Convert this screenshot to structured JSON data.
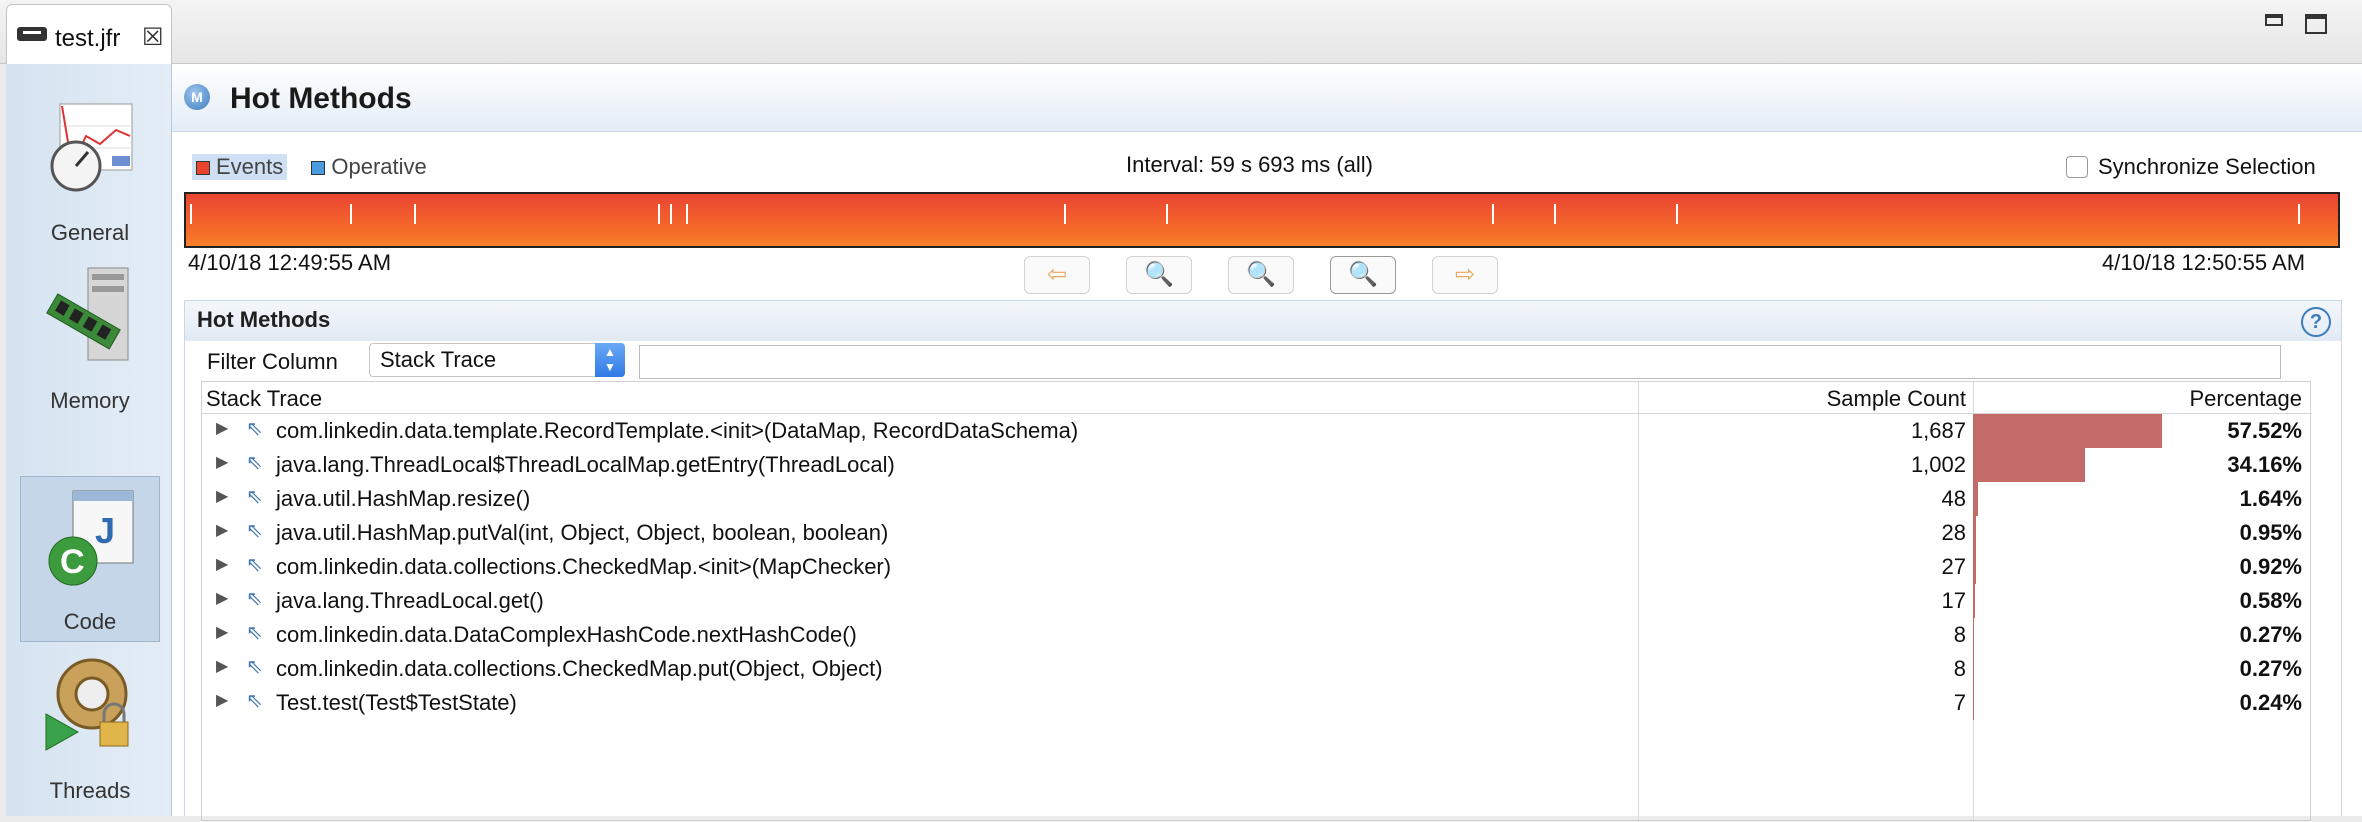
{
  "tab": {
    "title": "test.jfr",
    "close": "☒"
  },
  "sidebar": {
    "items": [
      {
        "label": "General",
        "selected": false
      },
      {
        "label": "Memory",
        "selected": false
      },
      {
        "label": "Code",
        "selected": true
      },
      {
        "label": "Threads",
        "selected": false
      }
    ]
  },
  "page": {
    "icon_letter": "M",
    "title": "Hot Methods"
  },
  "timeline": {
    "legend": [
      {
        "label": "Events",
        "color": "#e8452c",
        "active": true
      },
      {
        "label": "Operative",
        "color": "#4a9be0",
        "active": false
      }
    ],
    "interval": "Interval: 59 s 693 ms (all)",
    "sync_label": "Synchronize Selection",
    "start_time": "4/10/18 12:49:55 AM",
    "end_time": "4/10/18 12:50:55 AM",
    "buttons": {
      "back": "⇦",
      "zoom_out": "🔍",
      "zoom_out_alt": "🔍",
      "zoom_in": "🔍",
      "forward": "⇨"
    }
  },
  "section": {
    "title": "Hot Methods",
    "help": "?",
    "filter_label": "Filter Column",
    "filter_value": "Stack Trace",
    "filter_text": ""
  },
  "table": {
    "columns": [
      "Stack Trace",
      "Sample Count",
      "Percentage"
    ],
    "rows": [
      {
        "trace": "com.linkedin.data.template.RecordTemplate.<init>(DataMap, RecordDataSchema)",
        "count": "1,687",
        "pct": "57.52%",
        "frac": 0.5752
      },
      {
        "trace": "java.lang.ThreadLocal$ThreadLocalMap.getEntry(ThreadLocal)",
        "count": "1,002",
        "pct": "34.16%",
        "frac": 0.3416
      },
      {
        "trace": "java.util.HashMap.resize()",
        "count": "48",
        "pct": "1.64%",
        "frac": 0.0164
      },
      {
        "trace": "java.util.HashMap.putVal(int, Object, Object, boolean, boolean)",
        "count": "28",
        "pct": "0.95%",
        "frac": 0.0095
      },
      {
        "trace": "com.linkedin.data.collections.CheckedMap.<init>(MapChecker)",
        "count": "27",
        "pct": "0.92%",
        "frac": 0.0092
      },
      {
        "trace": "java.lang.ThreadLocal.get()",
        "count": "17",
        "pct": "0.58%",
        "frac": 0.0058
      },
      {
        "trace": "com.linkedin.data.DataComplexHashCode.nextHashCode()",
        "count": "8",
        "pct": "0.27%",
        "frac": 0.0027
      },
      {
        "trace": "com.linkedin.data.collections.CheckedMap.put(Object, Object)",
        "count": "8",
        "pct": "0.27%",
        "frac": 0.0027
      },
      {
        "trace": "Test.test(Test$TestState)",
        "count": "7",
        "pct": "0.24%",
        "frac": 0.0024
      }
    ]
  }
}
